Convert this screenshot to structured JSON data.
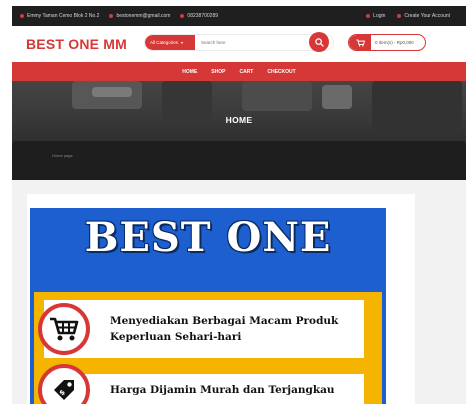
{
  "topbar": {
    "address": "Emmy Taman Cemo Blok 2 No.2",
    "email": "bestonemm@gmail.com",
    "phone": "08238700289",
    "login": "Login",
    "create_account": "Create Your Account"
  },
  "header": {
    "logo": "BEST ONE MM",
    "category_label": "All Categories",
    "search_placeholder": "Search here",
    "cart_text": "0 Item(s) - Rp0,000"
  },
  "nav": {
    "items": [
      "HOME",
      "SHOP",
      "CART",
      "CHECKOUT"
    ]
  },
  "hero": {
    "title": "HOME",
    "small_text": "Home page"
  },
  "banner": {
    "title": "BEST ONE",
    "features": [
      {
        "text_line1": "Menyediakan Berbagai Macam Produk",
        "text_line2": "Keperluan Sehari-hari",
        "icon": "shopping-cart-icon"
      },
      {
        "text_line1": "Harga Dijamin Murah dan Terjangkau",
        "icon": "price-tag-icon"
      }
    ]
  },
  "colors": {
    "brand_red": "#d63838",
    "topbar_bg": "#1f1f1f",
    "banner_blue": "#1e5fd0",
    "banner_yellow": "#f5b400"
  }
}
